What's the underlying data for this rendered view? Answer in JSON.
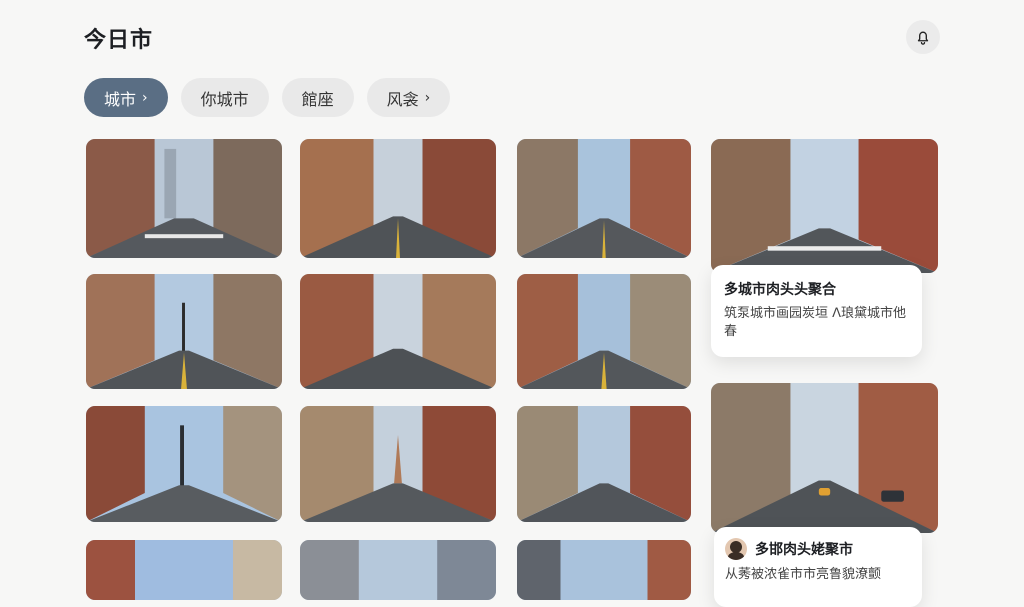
{
  "header": {
    "title": "今日市"
  },
  "chips": [
    {
      "label": "城市",
      "chevron": "›",
      "active": true
    },
    {
      "label": "你城市",
      "chevron": "",
      "active": false
    },
    {
      "label": "館座",
      "chevron": "",
      "active": false
    },
    {
      "label": "风衾",
      "chevron": "›",
      "active": false
    }
  ],
  "cards": [
    {
      "title": "多城市肉头头聚合",
      "desc": "筑泵城市画园炭垣 ᐱ琅黛城市他春"
    },
    {
      "title": "多邯肉头姥聚市",
      "desc": "从莠被浓雀市市亮鲁貌潦颤"
    }
  ],
  "icons": {
    "bell": "bell-icon",
    "avatar": "avatar"
  },
  "colors": {
    "active_chip": "#5a6e84",
    "chip": "#e9e9e9",
    "background": "#f7f7f6"
  }
}
